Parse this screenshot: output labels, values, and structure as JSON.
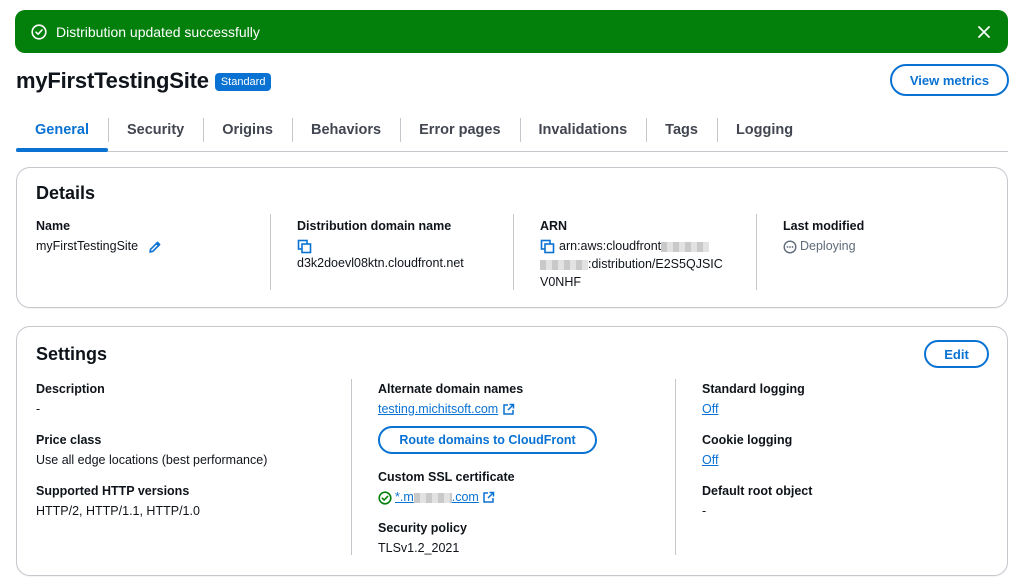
{
  "flash": {
    "message": "Distribution updated successfully",
    "type": "success",
    "color": "#037f0c",
    "icon": "check-circle-icon",
    "close_icon": "close-icon"
  },
  "header": {
    "title": "myFirstTestingSite",
    "badge": "Standard",
    "view_metrics": "View metrics"
  },
  "tabs": [
    "General",
    "Security",
    "Origins",
    "Behaviors",
    "Error pages",
    "Invalidations",
    "Tags",
    "Logging"
  ],
  "active_tab": "General",
  "details": {
    "heading": "Details",
    "name": {
      "label": "Name",
      "value": "myFirstTestingSite",
      "icon": "edit-pencil-icon"
    },
    "domain": {
      "label": "Distribution domain name",
      "value": "d3k2doevl08ktn.cloudfront.net",
      "icon": "copy-icon"
    },
    "arn": {
      "label": "ARN",
      "value_prefix": "arn:aws:cloudfront",
      "value_suffix": ":distribution/E2S5QJSIC",
      "value_end": "V0NHF",
      "icon": "copy-icon"
    },
    "last_modified": {
      "label": "Last modified",
      "value": "Deploying",
      "icon": "in-progress-icon"
    }
  },
  "settings": {
    "heading": "Settings",
    "edit": "Edit",
    "description": {
      "label": "Description",
      "value": "-"
    },
    "price_class": {
      "label": "Price class",
      "value": "Use all edge locations (best performance)"
    },
    "http_versions": {
      "label": "Supported HTTP versions",
      "value": "HTTP/2, HTTP/1.1, HTTP/1.0"
    },
    "alternate_domains": {
      "label": "Alternate domain names",
      "value": "testing.michitsoft.com",
      "icon": "external-link-icon"
    },
    "route_button": "Route domains to CloudFront",
    "ssl_cert": {
      "label": "Custom SSL certificate",
      "value_prefix": "*.m",
      "value_suffix": ".com",
      "icon": "check-circle-icon"
    },
    "security_policy": {
      "label": "Security policy",
      "value": "TLSv1.2_2021"
    },
    "standard_logging": {
      "label": "Standard logging",
      "value": "Off"
    },
    "cookie_logging": {
      "label": "Cookie logging",
      "value": "Off"
    },
    "default_root": {
      "label": "Default root object",
      "value": "-"
    }
  },
  "colors": {
    "primary": "#0972d3",
    "success": "#037f0c",
    "border": "#c6c6cd"
  }
}
